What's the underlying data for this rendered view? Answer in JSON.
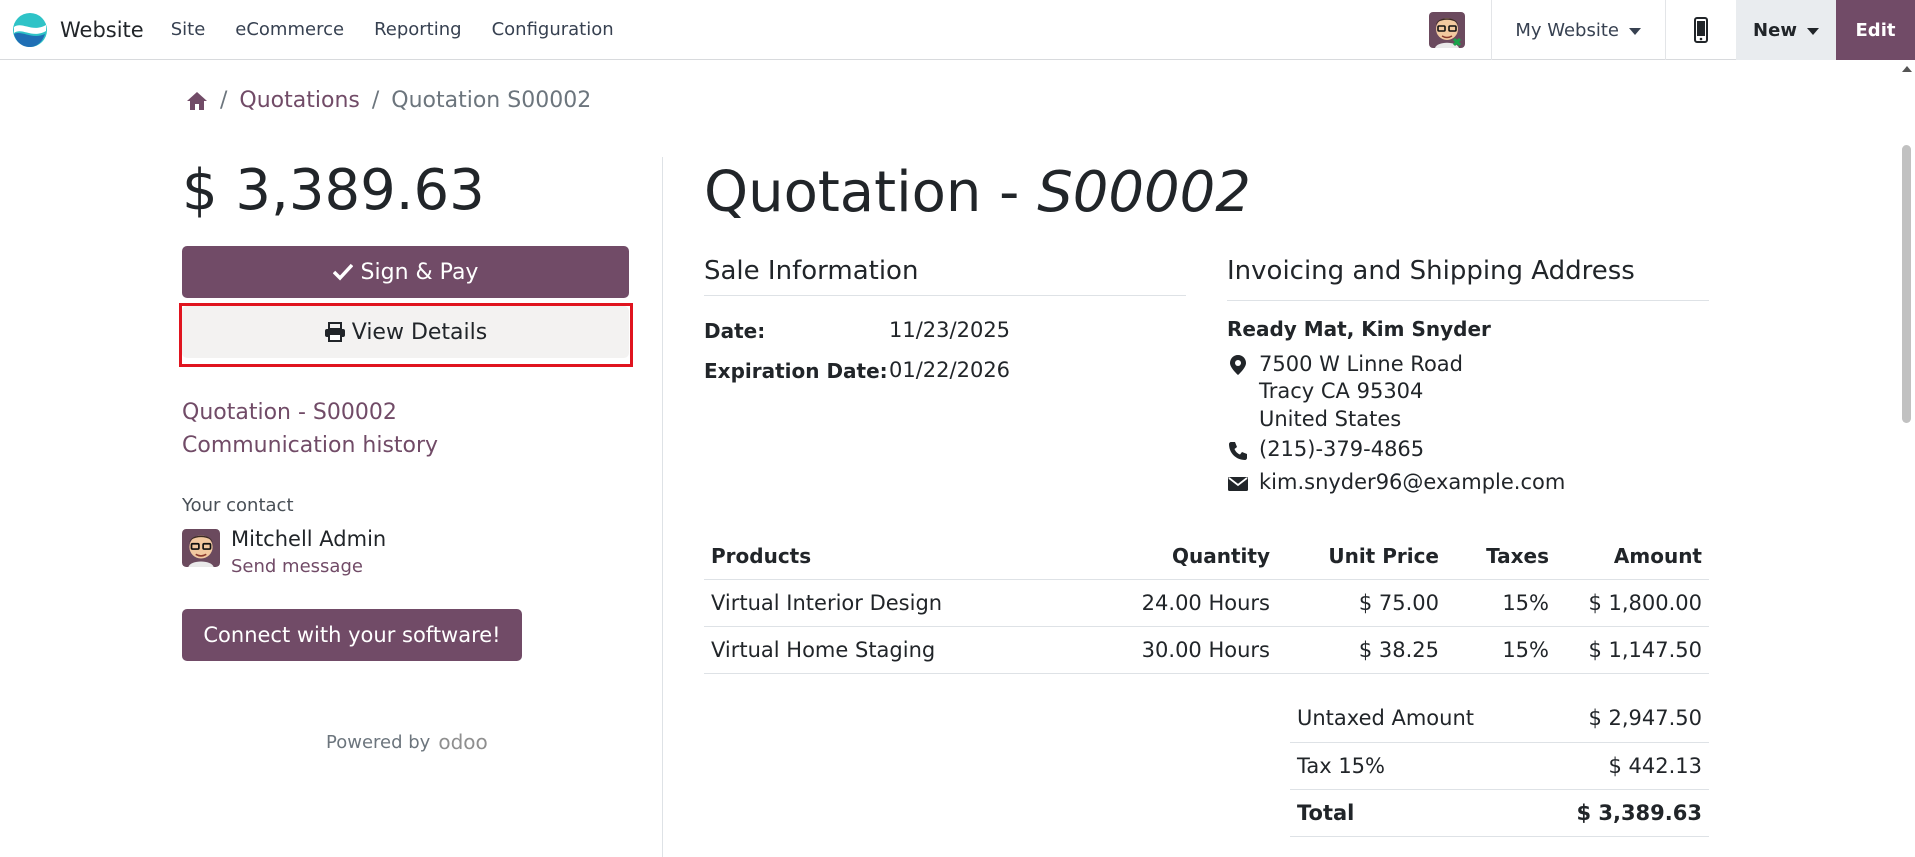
{
  "navbar": {
    "app_name": "Website",
    "menu": [
      "Site",
      "eCommerce",
      "Reporting",
      "Configuration"
    ],
    "site_selector": "My Website",
    "new_label": "New",
    "edit_label": "Edit"
  },
  "breadcrumb": {
    "home_icon": "home-icon",
    "items": [
      "Quotations",
      "Quotation S00002"
    ]
  },
  "summary": {
    "total": "$ 3,389.63",
    "sign_pay_label": "Sign & Pay",
    "view_details_label": "View Details",
    "links": [
      "Quotation - S00002",
      "Communication history"
    ],
    "contact_label": "Your contact",
    "contact_name": "Mitchell Admin",
    "send_message": "Send message",
    "connect_label": "Connect with your software!",
    "powered_by": "Powered by",
    "powered_logo": "odoo"
  },
  "document": {
    "title_prefix": "Quotation - ",
    "title_ref": "S00002",
    "sale_info_title": "Sale Information",
    "date_label": "Date:",
    "date_value": "11/23/2025",
    "expiration_label": "Expiration Date:",
    "expiration_value": "01/22/2026",
    "address_title": "Invoicing and Shipping Address",
    "customer": "Ready Mat, Kim Snyder",
    "address_lines": [
      "7500 W Linne Road",
      "Tracy CA 95304",
      "United States"
    ],
    "phone": "(215)-379-4865",
    "email": "kim.snyder96@example.com"
  },
  "products": {
    "headers": [
      "Products",
      "Quantity",
      "Unit Price",
      "Taxes",
      "Amount"
    ],
    "rows": [
      [
        "Virtual Interior Design",
        "24.00 Hours",
        "$ 75.00",
        "15%",
        "$ 1,800.00"
      ],
      [
        "Virtual Home Staging",
        "30.00 Hours",
        "$ 38.25",
        "15%",
        "$ 1,147.50"
      ]
    ]
  },
  "totals": [
    [
      "Untaxed Amount",
      "$ 2,947.50"
    ],
    [
      "Tax 15%",
      "$ 442.13"
    ],
    [
      "Total",
      "$ 3,389.63"
    ]
  ],
  "colors": {
    "brand": "#714b67",
    "highlight": "#e0141f"
  }
}
